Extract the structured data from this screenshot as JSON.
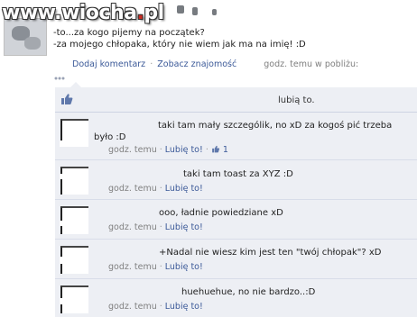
{
  "watermark": {
    "prefix": "www.",
    "brand": "wiocha",
    "dot": ".",
    "tld": "pl"
  },
  "status": {
    "line1": "-to...za kogo pijemy na początek?",
    "line2": "-za mojego chłopaka, który nie wiem jak ma na imię! :D"
  },
  "post_meta": {
    "comment_link": "Dodaj komentarz",
    "friendship_link": "Zobacz znajomość",
    "separator": "·",
    "time_place": "godz. temu w pobliżu:"
  },
  "likes": {
    "text": "lubią to."
  },
  "comments": [
    {
      "text_line1": "taki tam mały szczególik, no xD za kogoś pić trzeba",
      "text_line2": "było :D",
      "time": "godz. temu",
      "like_link": "Lubię to!",
      "like_count": "1"
    },
    {
      "text": "taki tam toast za XYZ :D",
      "time": "godz. temu",
      "like_link": "Lubię to!"
    },
    {
      "text": "ooo, ładnie powiedziane xD",
      "time": "godz. temu",
      "like_link": "Lubię to!"
    },
    {
      "text": "+Nadal nie wiesz kim jest ten \"twój chłopak\"? xD",
      "time": "godz. temu",
      "like_link": "Lubię to!"
    },
    {
      "text": "huehuehue, no nie bardzo..:D",
      "time": "godz. temu",
      "like_link": "Lubię to!"
    }
  ],
  "colors": {
    "link": "#3b5998",
    "feed_background": "#edeff4",
    "meta_gray": "#808080",
    "watermark_accent": "#cc2a22"
  },
  "icons": {
    "like_row": "thumbs-up-icon",
    "comment_like": "thumbs-up-icon",
    "feed": "chat-bubbles-icon"
  }
}
